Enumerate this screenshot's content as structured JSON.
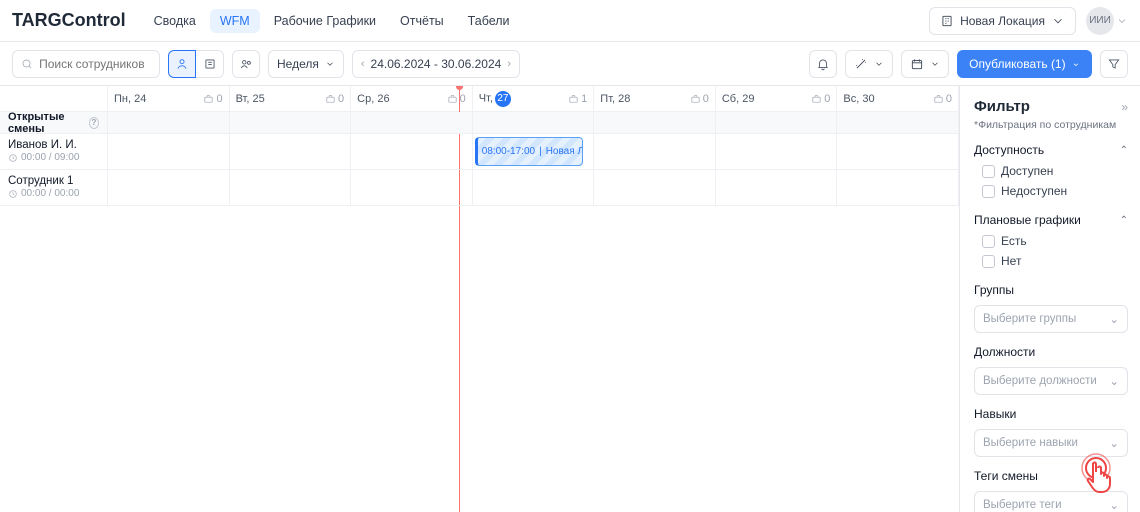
{
  "brand": "TARGControl",
  "nav": [
    "Сводка",
    "WFM",
    "Рабочие Графики",
    "Отчёты",
    "Табели"
  ],
  "nav_active": 1,
  "location": "Новая Локация",
  "avatar": "ИИИ",
  "search_placeholder": "Поиск сотрудников",
  "period_label": "Неделя",
  "date_range": "24.06.2024 - 30.06.2024",
  "publish_label": "Опубликовать (1)",
  "days": [
    {
      "label": "Пн,",
      "num": "24",
      "cnt": "0"
    },
    {
      "label": "Вт,",
      "num": "25",
      "cnt": "0"
    },
    {
      "label": "Ср,",
      "num": "26",
      "cnt": "0"
    },
    {
      "label": "Чт,",
      "num": "27",
      "cnt": "1",
      "today": true
    },
    {
      "label": "Пт,",
      "num": "28",
      "cnt": "0"
    },
    {
      "label": "Сб,",
      "num": "29",
      "cnt": "0"
    },
    {
      "label": "Вс,",
      "num": "30",
      "cnt": "0"
    }
  ],
  "open_shifts_label": "Открытые смены",
  "rows": [
    {
      "name": "Иванов И. И.",
      "sub": "00:00 / 09:00"
    },
    {
      "name": "Сотрудник 1",
      "sub": "00:00 / 00:00"
    }
  ],
  "shift": {
    "time": "08:00-17:00",
    "loc": "Новая Локация"
  },
  "filter": {
    "title": "Фильтр",
    "sub": "*Фильтрация по сотрудникам",
    "availability": {
      "label": "Доступность",
      "opts": [
        "Доступен",
        "Недоступен"
      ]
    },
    "plans": {
      "label": "Плановые графики",
      "opts": [
        "Есть",
        "Нет"
      ]
    },
    "groups": {
      "label": "Группы",
      "ph": "Выберите группы"
    },
    "positions": {
      "label": "Должности",
      "ph": "Выберите должности"
    },
    "skills": {
      "label": "Навыки",
      "ph": "Выберите навыки"
    },
    "tags": {
      "label": "Теги смены",
      "ph": "Выберите теги"
    }
  }
}
